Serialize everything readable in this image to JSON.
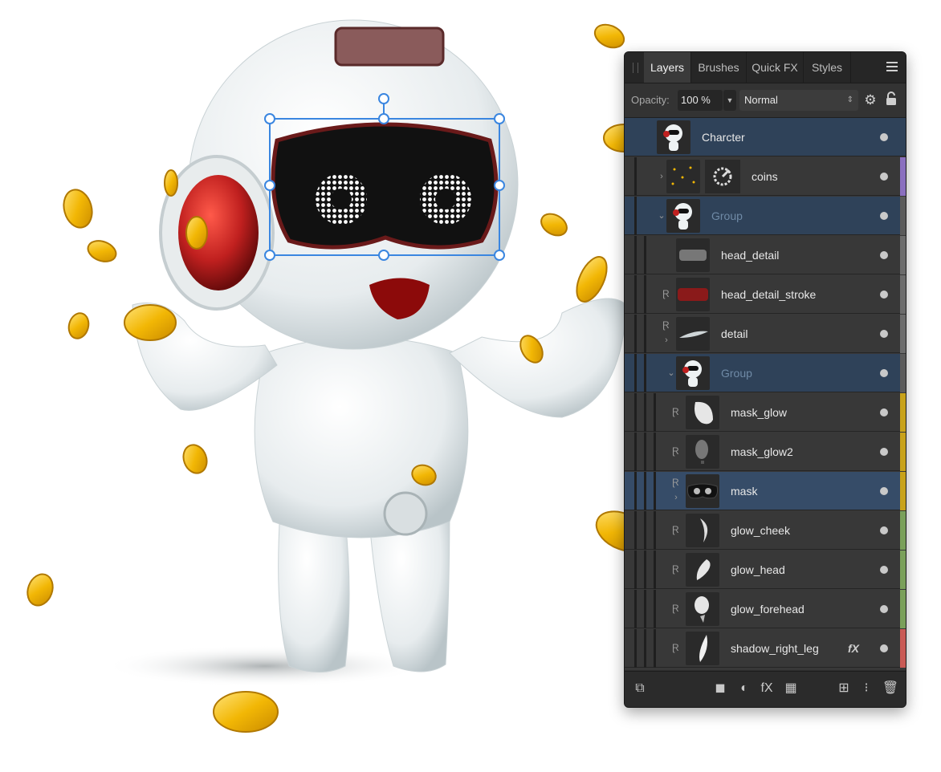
{
  "panel": {
    "tabs": [
      "Layers",
      "Brushes",
      "Quick FX",
      "Styles"
    ],
    "active_tab": "Layers",
    "menu_icon": "hamburger-menu-icon"
  },
  "options": {
    "opacity_label": "Opacity:",
    "opacity_value": "100 %",
    "blend_mode": "Normal",
    "settings_icon": "gear-icon",
    "lock_icon": "lock-icon"
  },
  "layers": [
    {
      "name": "Charcter",
      "dim": false,
      "selected": "dark",
      "thumb": "robot",
      "tag": null,
      "fx": "",
      "clip": false,
      "expander": ""
    },
    {
      "name": "coins",
      "dim": false,
      "selected": "",
      "thumb": "sparks",
      "tag": "#8a6fbf",
      "fx": "",
      "clip": false,
      "expander": ">"
    },
    {
      "name": "Group",
      "dim": true,
      "selected": "dark",
      "thumb": "robot",
      "tag": "#5b5b5b",
      "fx": "",
      "clip": false,
      "expander": "v"
    },
    {
      "name": "head_detail",
      "dim": false,
      "selected": "",
      "thumb": "grille",
      "tag": "#6c6c6c",
      "fx": "",
      "clip": false,
      "expander": ""
    },
    {
      "name": "head_detail_stroke",
      "dim": false,
      "selected": "",
      "thumb": "redbar",
      "tag": "#6c6c6c",
      "fx": "",
      "clip": true,
      "expander": ""
    },
    {
      "name": "detail",
      "dim": false,
      "selected": "",
      "thumb": "sliver",
      "tag": "#6c6c6c",
      "fx": "",
      "clip": true,
      "expander": ">"
    },
    {
      "name": "Group",
      "dim": true,
      "selected": "dark",
      "thumb": "robot",
      "tag": "#5b5b5b",
      "fx": "",
      "clip": false,
      "expander": "v"
    },
    {
      "name": "mask_glow",
      "dim": false,
      "selected": "",
      "thumb": "glowA",
      "tag": "#c8a21a",
      "fx": "",
      "clip": true,
      "expander": ""
    },
    {
      "name": "mask_glow2",
      "dim": false,
      "selected": "",
      "thumb": "glowB",
      "tag": "#c8a21a",
      "fx": "",
      "clip": true,
      "expander": ""
    },
    {
      "name": "mask",
      "dim": false,
      "selected": "blue",
      "thumb": "mask",
      "tag": "#c8a21a",
      "fx": "",
      "clip": true,
      "expander": ">"
    },
    {
      "name": "glow_cheek",
      "dim": false,
      "selected": "",
      "thumb": "cheek",
      "tag": "#7aa05a",
      "fx": "",
      "clip": true,
      "expander": ""
    },
    {
      "name": "glow_head",
      "dim": false,
      "selected": "",
      "thumb": "head",
      "tag": "#7aa05a",
      "fx": "",
      "clip": true,
      "expander": ""
    },
    {
      "name": "glow_forehead",
      "dim": false,
      "selected": "",
      "thumb": "forehead",
      "tag": "#7aa05a",
      "fx": "",
      "clip": true,
      "expander": ""
    },
    {
      "name": "shadow_right_leg",
      "dim": false,
      "selected": "",
      "thumb": "leg",
      "tag": "#c95a55",
      "fx": "fX",
      "clip": true,
      "expander": ""
    }
  ],
  "bottom_icons": [
    "layers-stack-icon",
    "mask-icon",
    "adjustment-icon",
    "fx-icon",
    "live-filter-icon",
    "add-pixel-layer-icon",
    "group-icon",
    "trash-icon"
  ],
  "bottom_glyphs": [
    "⧉",
    "◼",
    "◐",
    "fX",
    "▦",
    "⊞",
    "⁝",
    "🗑"
  ],
  "colors": {
    "panel_bg": "#2e2e2e",
    "selected_blue": "#364c68",
    "selected_dark": "#2f4259",
    "robot_eye_red": "#c0201f",
    "coin_gold": "#f2b705",
    "selection_handle": "#3a86e0"
  }
}
